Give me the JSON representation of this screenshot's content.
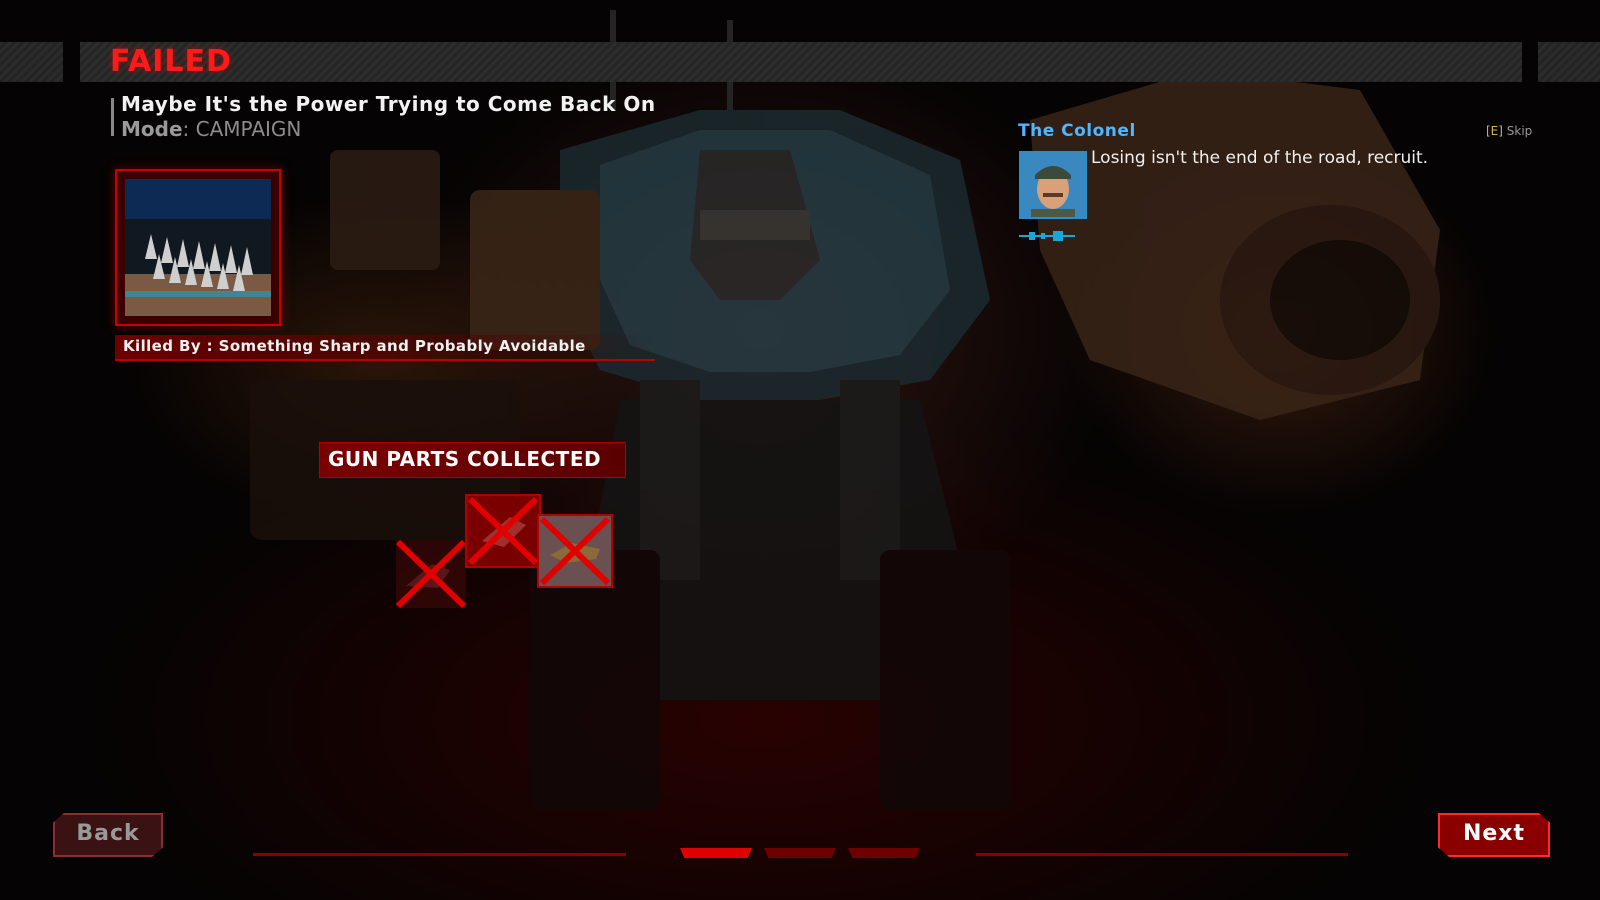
{
  "header": {
    "status": "FAILED"
  },
  "level": {
    "title": "Maybe It's the Power Trying to Come Back On",
    "mode_label": "Mode",
    "mode_value": "CAMPAIGN"
  },
  "killed_by": {
    "label": "Killed By : Something Sharp and Probably Avoidable"
  },
  "gun_parts": {
    "title": "GUN PARTS COLLECTED",
    "parts": [
      {
        "name": "gun-part-1",
        "collected": false
      },
      {
        "name": "gun-part-2",
        "collected": false
      },
      {
        "name": "gun-part-3",
        "collected": false
      }
    ]
  },
  "dialogue": {
    "speaker": "The Colonel",
    "skip_key": "[E]",
    "skip_label": "Skip",
    "text": "Losing isn't the end of the road, recruit."
  },
  "nav": {
    "back_label": "Back",
    "next_label": "Next",
    "pages": [
      {
        "active": true
      },
      {
        "active": false
      },
      {
        "active": false
      }
    ]
  },
  "colors": {
    "accent_red": "#ff1a1a",
    "speaker_blue": "#4fb6ff",
    "skip_key_gold": "#d8b24a"
  }
}
